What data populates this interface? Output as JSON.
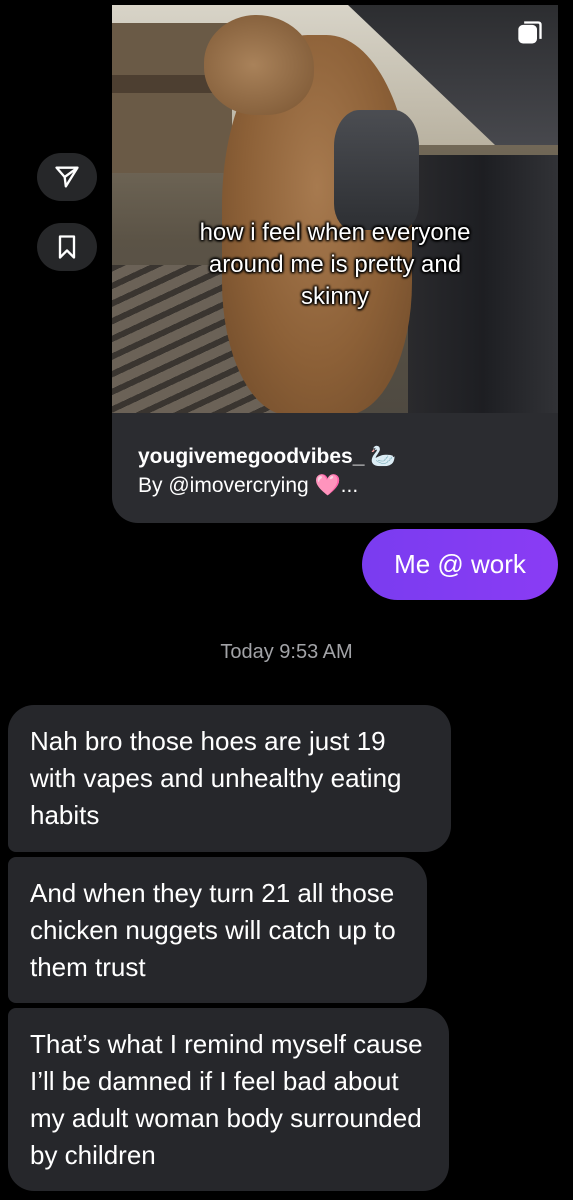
{
  "side_actions": {
    "share_icon": "paper-plane-icon",
    "save_icon": "bookmark-icon"
  },
  "shared_post": {
    "image_caption": "how i feel when everyone\naround me is pretty and\nskinny",
    "username": "yougivemegoodvibes_ 🦢",
    "byline": "By @imovercrying 🩷...",
    "multi_icon": "carousel-icon"
  },
  "messages": {
    "sent": [
      {
        "text": "Me @ work"
      }
    ],
    "timestamp": "Today 9:53 AM",
    "received": [
      {
        "text": "Nah bro those hoes are just 19 with vapes and unhealthy eating habits"
      },
      {
        "text": "And when they turn 21 all those chicken nuggets will catch up to them trust"
      },
      {
        "text": "That’s what I remind myself cause I’ll be damned if I feel bad about my adult woman body surrounded by children"
      }
    ]
  },
  "colors": {
    "background": "#000000",
    "sent_bubble": "#7d3cf2",
    "received_bubble": "#26272b",
    "card": "#2b2c30"
  }
}
